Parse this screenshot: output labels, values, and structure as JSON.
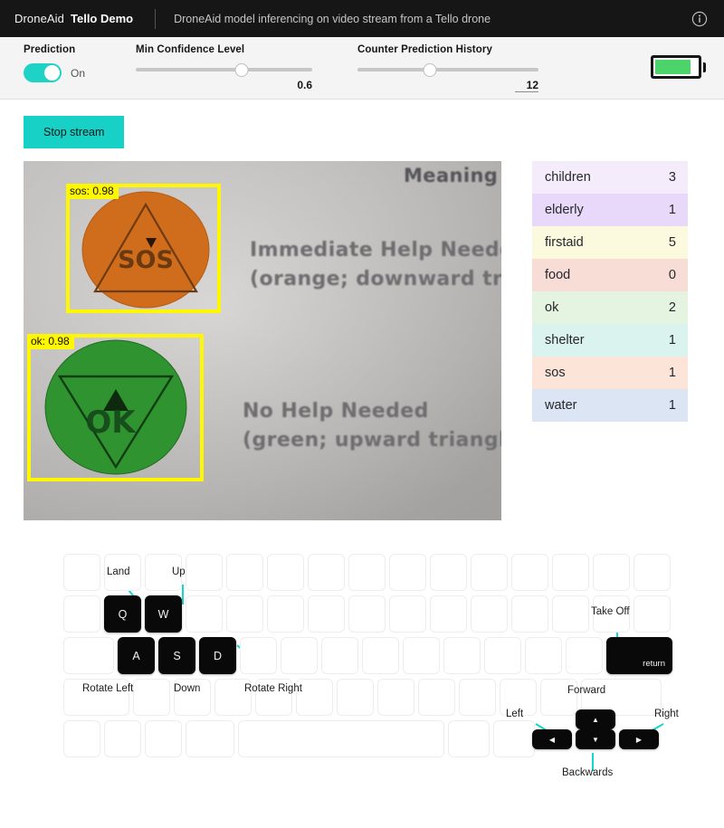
{
  "topbar": {
    "brand_prefix": "DroneAid",
    "brand_name": "Tello Demo",
    "subtitle": "DroneAid model inferencing on video stream from a Tello drone",
    "info_icon": "info-icon"
  },
  "controls": {
    "prediction": {
      "label": "Prediction",
      "state": "On",
      "enabled": true
    },
    "min_confidence": {
      "label": "Min Confidence Level",
      "value": "0.6",
      "percent": 60
    },
    "counter_history": {
      "label": "Counter Prediction History",
      "value": "12",
      "percent": 40
    },
    "battery": {
      "percent": 85,
      "color": "#4cd369"
    }
  },
  "stream": {
    "button_label": "Stop stream",
    "button_color": "#17d1c6"
  },
  "video": {
    "overlay_text": {
      "heading": "Meaning",
      "line1": "Immediate Help Needed",
      "line2": "(orange; downward trian",
      "line3": "No Help Needed",
      "line4": "(green; upward triangle"
    },
    "detections": [
      {
        "label": "sos: 0.98",
        "class": "sos",
        "confidence": "0.98",
        "box_color": "#fff700"
      },
      {
        "label": "ok: 0.98",
        "class": "ok",
        "confidence": "0.98",
        "box_color": "#fff700"
      }
    ],
    "symbols": [
      {
        "name": "sos-symbol",
        "text": "SOS",
        "color": "#d4701f"
      },
      {
        "name": "ok-symbol",
        "text": "OK",
        "color": "#2f9a2f"
      }
    ]
  },
  "predictions": {
    "rows": [
      {
        "label": "children",
        "count": "3",
        "color": "#f4ecfb"
      },
      {
        "label": "elderly",
        "count": "1",
        "color": "#e8d8fa"
      },
      {
        "label": "firstaid",
        "count": "5",
        "color": "#fcfade"
      },
      {
        "label": "food",
        "count": "0",
        "color": "#f7ddd6"
      },
      {
        "label": "ok",
        "count": "2",
        "color": "#e4f4e0"
      },
      {
        "label": "shelter",
        "count": "1",
        "color": "#daf3ef"
      },
      {
        "label": "sos",
        "count": "1",
        "color": "#fce5d8"
      },
      {
        "label": "water",
        "count": "1",
        "color": "#dbe5f3"
      }
    ]
  },
  "keyboard": {
    "active_keys": [
      {
        "key": "Q",
        "action": "Land"
      },
      {
        "key": "W",
        "action": "Up"
      },
      {
        "key": "A",
        "action": "Rotate Left"
      },
      {
        "key": "S",
        "action": "Down"
      },
      {
        "key": "D",
        "action": "Rotate Right"
      },
      {
        "key": "return",
        "action": "Take Off"
      },
      {
        "key": "left-arrow",
        "action": "Left"
      },
      {
        "key": "up-arrow",
        "action": "Forward"
      },
      {
        "key": "down-arrow",
        "action": "Backwards"
      },
      {
        "key": "right-arrow",
        "action": "Right"
      }
    ],
    "labels": {
      "q": "Q",
      "w": "W",
      "a": "A",
      "s": "S",
      "d": "D",
      "return": "return",
      "land": "Land",
      "up": "Up",
      "rotate_left": "Rotate Left",
      "down": "Down",
      "rotate_right": "Rotate Right",
      "take_off": "Take Off",
      "left": "Left",
      "forward": "Forward",
      "backwards": "Backwards",
      "right": "Right"
    },
    "leader_color": "#15d6cb"
  }
}
